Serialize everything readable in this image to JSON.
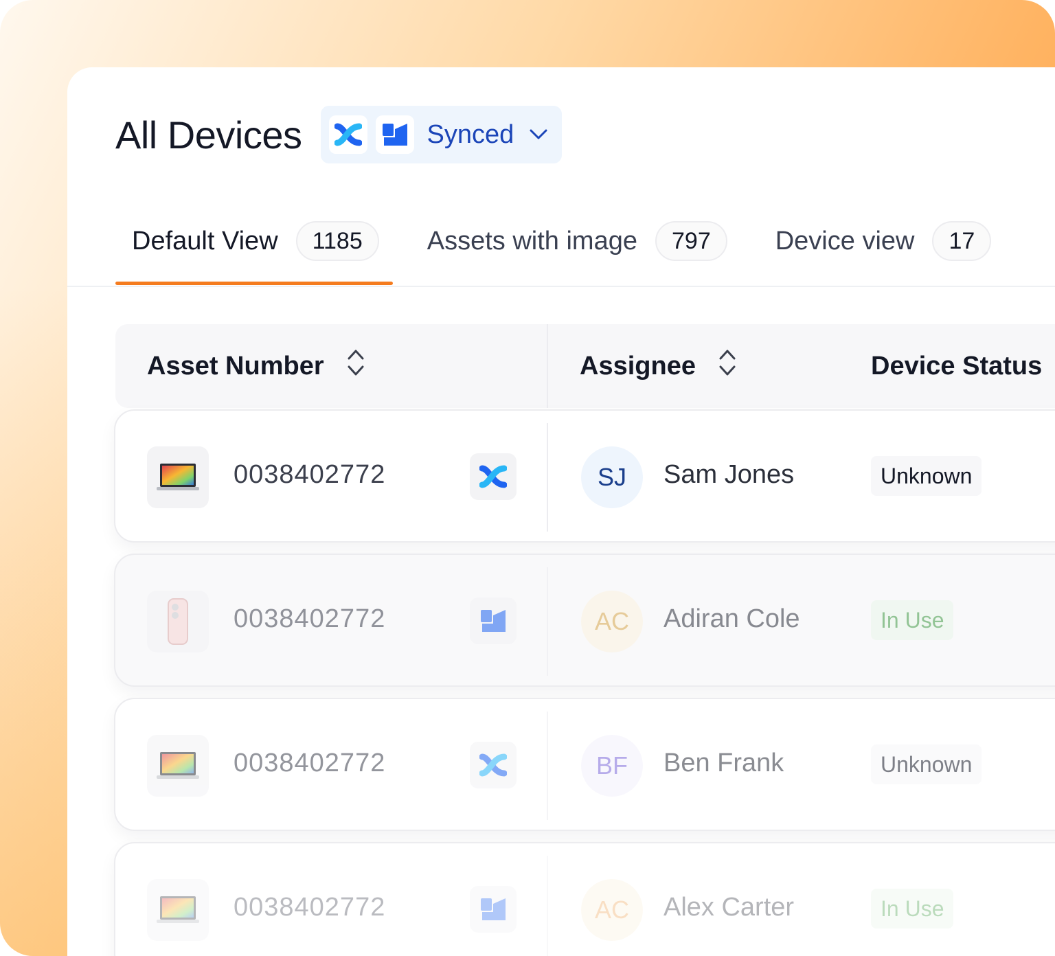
{
  "header": {
    "title": "All Devices",
    "sync": {
      "label": "Synced",
      "icons": [
        "kandji-icon",
        "jamf-icon"
      ]
    }
  },
  "tabs": [
    {
      "label": "Default View",
      "count": "1185",
      "active": true
    },
    {
      "label": "Assets with image",
      "count": "797",
      "active": false
    },
    {
      "label": "Device view",
      "count": "17",
      "active": false
    }
  ],
  "table": {
    "columns": {
      "asset_number": "Asset Number",
      "assignee": "Assignee",
      "device_status": "Device Status"
    },
    "rows": [
      {
        "asset_number": "0038402772",
        "device_icon": "laptop-icon",
        "source_icon": "kandji-icon",
        "initials": "SJ",
        "assignee": "Sam Jones",
        "status": "Unknown"
      },
      {
        "asset_number": "0038402772",
        "device_icon": "phone-icon",
        "source_icon": "jamf-icon",
        "initials": "AC",
        "assignee": "Adiran Cole",
        "status": "In Use"
      },
      {
        "asset_number": "0038402772",
        "device_icon": "laptop-icon",
        "source_icon": "kandji-icon",
        "initials": "BF",
        "assignee": "Ben Frank",
        "status": "Unknown"
      },
      {
        "asset_number": "0038402772",
        "device_icon": "laptop-icon",
        "source_icon": "jamf-icon",
        "initials": "AC",
        "assignee": "Alex Carter",
        "status": "In Use"
      }
    ]
  },
  "colors": {
    "accent": "#f57c1f",
    "sync_text": "#1b45b8",
    "in_use": "#3f9a43",
    "avatar_sj": "#1b3f8c",
    "avatar_ac": "#d8a64b",
    "avatar_bf": "#7b68d9"
  }
}
